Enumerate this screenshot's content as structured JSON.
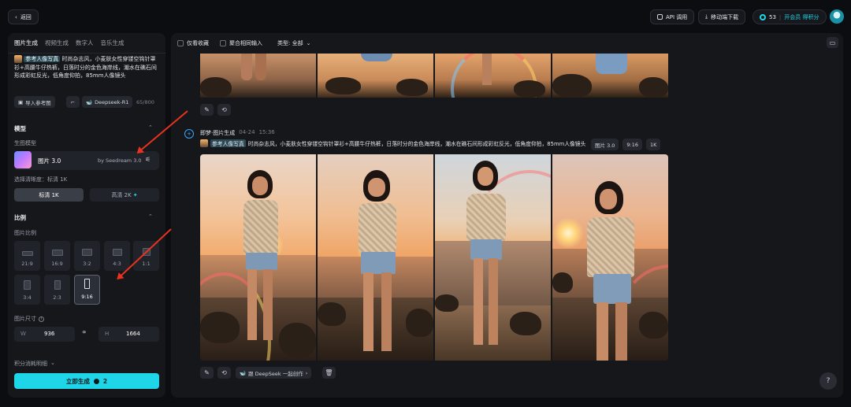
{
  "topbar": {
    "back_label": "返回",
    "api_label": "API 调用",
    "download_label": "移动端下载",
    "credits_count": "53",
    "vip_label": "开会员 得积分"
  },
  "left": {
    "tabs": [
      {
        "label": "图片生成",
        "active": true
      },
      {
        "label": "视频生成",
        "active": false
      },
      {
        "label": "数字人",
        "active": false
      },
      {
        "label": "音乐生成",
        "active": false
      }
    ],
    "prompt": {
      "ref_tag": "参考人像写真",
      "text": "时尚杂志风，小麦肤女性穿镂空钩针罩衫+高腰牛仔热裤，日落时分的金色海岸线，潮水在礁石间形成彩虹反光，低角度仰拍，85mm人像镜头",
      "import_label": "导入参考图",
      "deepseek_label": "Deepseek-R1",
      "counter": "65/800"
    },
    "model_section": {
      "title": "模型",
      "subtitle": "生图模型",
      "model_name": "图片 3.0",
      "model_by": "by Seedream 3.0",
      "clarity_label": "选择清晰度：标清 1K",
      "clarity_standard": "标清 1K",
      "clarity_high": "高清 2K"
    },
    "ratio_section": {
      "title": "比例",
      "subtitle": "图片比例",
      "ratios": [
        "21:9",
        "16:9",
        "3:2",
        "4:3",
        "1:1",
        "3:4",
        "2:3",
        "9:16"
      ],
      "selected": "9:16"
    },
    "size_section": {
      "title": "图片尺寸",
      "w_label": "W",
      "w_value": "936",
      "h_label": "H",
      "h_value": "1664"
    },
    "cost_label": "积分消耗明细",
    "generate_label": "立即生成",
    "generate_cost": "2"
  },
  "main": {
    "filters": {
      "only_favorites": "仅看收藏",
      "aggregate_input": "聚合相同输入",
      "type_label": "类型: 全部"
    },
    "record": {
      "source": "即梦·图片生成",
      "date": "04-24",
      "time": "15:36",
      "ref_tag": "参考人像写真",
      "prompt": "时尚杂志风，小麦肤女性穿镂空钩针罩衫+高腰牛仔热裤，日落时分的金色海岸线，潮水在礁石间形成彩虹反光，低角度仰拍，85mm人像镜头",
      "tags": [
        "图片 3.0",
        "9:16",
        "1K"
      ]
    },
    "deepseek_btn": "跟 DeepSeek 一起创作",
    "help": "?"
  },
  "colors": {
    "accent": "#1fd6e8",
    "arrow": "#e8321f",
    "bg": "#0c0d10",
    "panel": "#15171b"
  }
}
